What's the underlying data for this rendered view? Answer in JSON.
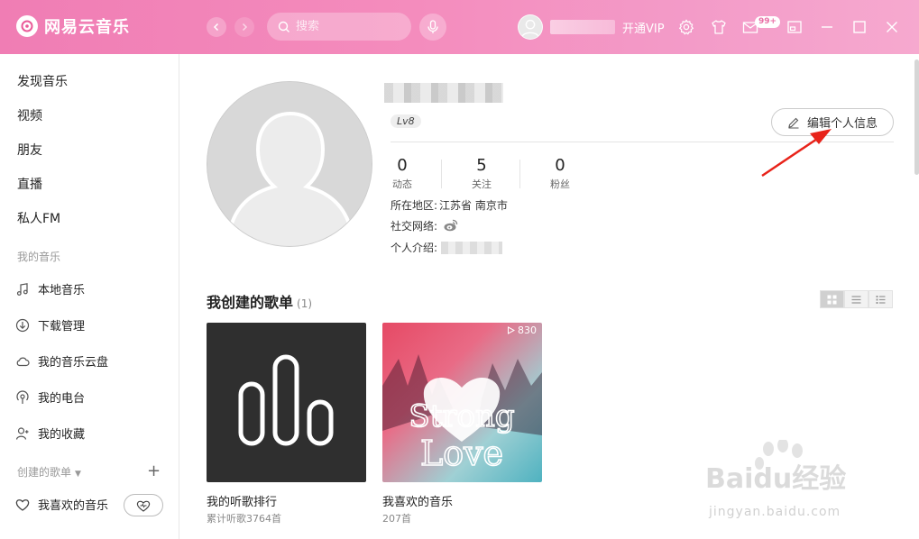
{
  "titlebar": {
    "app_name": "网易云音乐",
    "search_placeholder": "搜索",
    "vip_label": "开通VIP",
    "message_badge": "99+"
  },
  "sidebar": {
    "nav": [
      {
        "label": "发现音乐"
      },
      {
        "label": "视频"
      },
      {
        "label": "朋友"
      },
      {
        "label": "直播"
      },
      {
        "label": "私人FM"
      }
    ],
    "my_music_header": "我的音乐",
    "my_music": [
      {
        "label": "本地音乐",
        "icon": "music-note-icon"
      },
      {
        "label": "下载管理",
        "icon": "download-icon"
      },
      {
        "label": "我的音乐云盘",
        "icon": "cloud-icon"
      },
      {
        "label": "我的电台",
        "icon": "radio-icon"
      },
      {
        "label": "我的收藏",
        "icon": "collection-icon"
      }
    ],
    "created_header": "创建的歌单",
    "liked_playlist": "我喜欢的音乐"
  },
  "profile": {
    "level": "Lv8",
    "edit_label": "编辑个人信息",
    "stats": [
      {
        "num": "0",
        "label": "动态"
      },
      {
        "num": "5",
        "label": "关注"
      },
      {
        "num": "0",
        "label": "粉丝"
      }
    ],
    "region_label": "所在地区:",
    "region_value": "江苏省 南京市",
    "social_label": "社交网络:",
    "intro_label": "个人介绍:"
  },
  "playlists": {
    "section_title": "我创建的歌单",
    "section_count": "(1)",
    "items": [
      {
        "name": "我的听歌排行",
        "sub": "累计听歌3764首"
      },
      {
        "name": "我喜欢的音乐",
        "sub": "207首",
        "play_count": "830",
        "cover_text": [
          "Strong",
          "Love"
        ]
      }
    ]
  },
  "watermark": {
    "main": "Baidu经验",
    "sub": "jingyan.baidu.com"
  },
  "colors": {
    "titlebar_start": "#f07db4",
    "titlebar_end": "#f6a9cf",
    "annotation_arrow": "#e8231a"
  }
}
